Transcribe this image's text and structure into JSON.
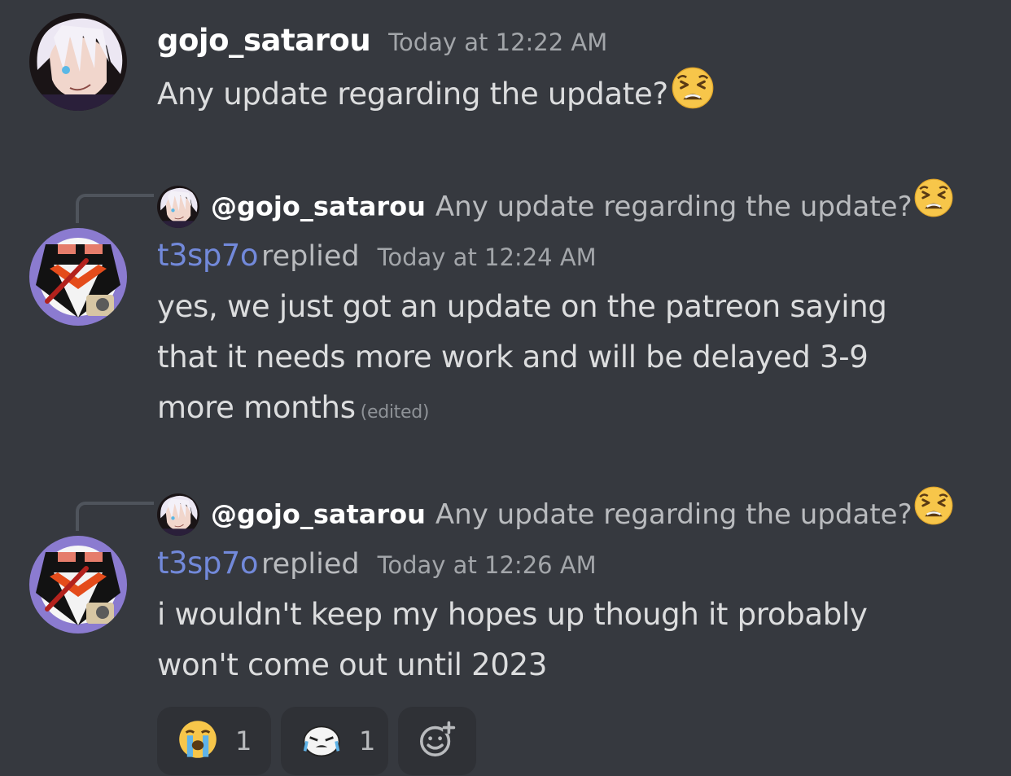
{
  "messages": [
    {
      "username": "gojo_satarou",
      "timestamp": "Today at 12:22 AM",
      "text": "Any update regarding the update?",
      "emoji": "weary-face"
    },
    {
      "reply_to": {
        "username": "@gojo_satarou",
        "text": "Any update regarding the update?",
        "emoji": "weary-face"
      },
      "username": "t3sp7o",
      "replied_label": "replied",
      "timestamp": "Today at 12:24 AM",
      "lines": [
        "yes, we just got an update on the patreon saying",
        "that it needs more work and will be delayed 3-9",
        "more months"
      ],
      "edited": "(edited)"
    },
    {
      "reply_to": {
        "username": "@gojo_satarou",
        "text": "Any update regarding the update?",
        "emoji": "weary-face"
      },
      "username": "t3sp7o",
      "replied_label": "replied",
      "timestamp": "Today at 12:26 AM",
      "lines": [
        "i wouldn't keep my hopes up though it probably",
        "won't come out until 2023"
      ]
    }
  ],
  "reactions": [
    {
      "emoji": "loudly-crying-face",
      "count": "1"
    },
    {
      "emoji": "custom-crying-emoji",
      "count": "1"
    },
    {
      "emoji": "add-reaction-icon"
    }
  ],
  "colors": {
    "background": "#36393f",
    "username_highlight": "#7289da",
    "reaction_bg": "#2f3136"
  }
}
